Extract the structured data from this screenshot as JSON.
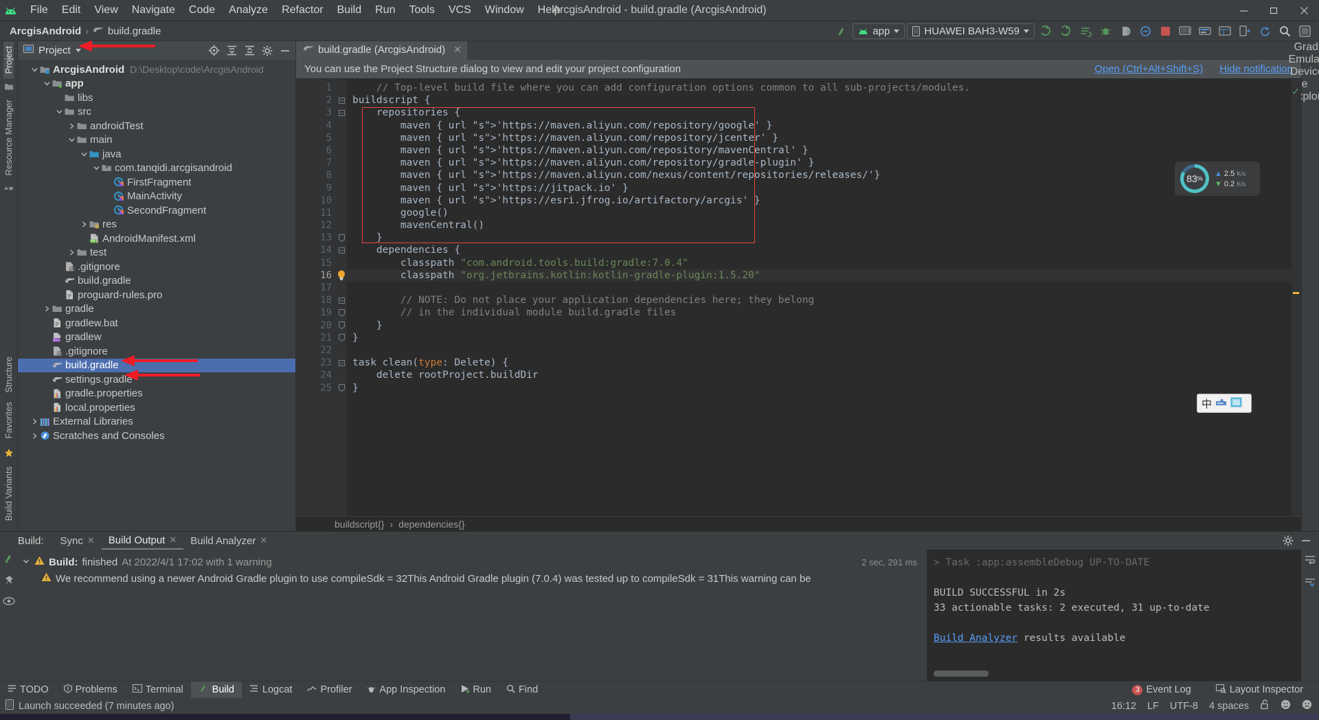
{
  "window": {
    "title": "ArcgisAndroid - build.gradle (ArcgisAndroid)",
    "app_icon": "android-logo-icon",
    "controls": {
      "minimize": "—",
      "maximize": "❐",
      "close": "✕"
    }
  },
  "menubar": [
    "File",
    "Edit",
    "View",
    "Navigate",
    "Code",
    "Analyze",
    "Refactor",
    "Build",
    "Run",
    "Tools",
    "VCS",
    "Window",
    "Help"
  ],
  "navbar": {
    "breadcrumb": {
      "project": "ArcgisAndroid",
      "separator": "›",
      "file": "build.gradle"
    },
    "run_config": {
      "label": "app",
      "icon": "android-icon"
    },
    "device": {
      "label": "HUAWEI BAH3-W59",
      "icon": "device-icon"
    },
    "icons": [
      "make-project-icon",
      "run-icon",
      "run-with-coverage-icon",
      "select-device-icon",
      "debug-icon",
      "attach-debugger-icon",
      "profiler-icon",
      "apply-changes-icon",
      "stop-icon",
      "avd-manager-icon",
      "sdk-manager-icon",
      "layout-inspector-icon",
      "device-manager-icon",
      "sync-gradle-icon",
      "search-everywhere-icon",
      "settings-icon"
    ]
  },
  "left_rail": {
    "items": [
      "Project",
      "Resource Manager"
    ],
    "bottom_items": [
      "Structure",
      "Favorites",
      "Build Variants"
    ]
  },
  "right_rail": {
    "items": [
      "Gradle",
      "Emulator",
      "Device File Explorer"
    ]
  },
  "project_panel": {
    "header": {
      "title": "Project",
      "icons": [
        "locate-icon",
        "expand-all-icon",
        "collapse-all-icon",
        "gear-icon",
        "hide-icon"
      ]
    },
    "tree": [
      {
        "depth": 0,
        "arrow": "down",
        "icon": "project-folder-icon",
        "label": "ArcgisAndroid",
        "bold": true,
        "path": "D:\\Desktop\\code\\ArcgisAndroid"
      },
      {
        "depth": 1,
        "arrow": "down",
        "icon": "module-folder-icon",
        "label": "app",
        "bold": true,
        "path": ""
      },
      {
        "depth": 2,
        "arrow": "none",
        "icon": "folder-icon",
        "label": "libs",
        "bold": false,
        "path": ""
      },
      {
        "depth": 2,
        "arrow": "down",
        "icon": "folder-icon",
        "label": "src",
        "bold": false,
        "path": ""
      },
      {
        "depth": 3,
        "arrow": "right",
        "icon": "folder-icon",
        "label": "androidTest",
        "bold": false,
        "path": ""
      },
      {
        "depth": 3,
        "arrow": "down",
        "icon": "folder-icon",
        "label": "main",
        "bold": false,
        "path": ""
      },
      {
        "depth": 4,
        "arrow": "down",
        "icon": "source-folder-icon",
        "label": "java",
        "bold": false,
        "path": ""
      },
      {
        "depth": 5,
        "arrow": "down",
        "icon": "package-icon",
        "label": "com.tanqidi.arcgisandroid",
        "bold": false,
        "path": ""
      },
      {
        "depth": 6,
        "arrow": "none",
        "icon": "kotlin-class-icon",
        "label": "FirstFragment",
        "bold": false,
        "path": ""
      },
      {
        "depth": 6,
        "arrow": "none",
        "icon": "kotlin-class-icon",
        "label": "MainActivity",
        "bold": false,
        "path": ""
      },
      {
        "depth": 6,
        "arrow": "none",
        "icon": "kotlin-class-icon",
        "label": "SecondFragment",
        "bold": false,
        "path": ""
      },
      {
        "depth": 4,
        "arrow": "right",
        "icon": "res-folder-icon",
        "label": "res",
        "bold": false,
        "path": ""
      },
      {
        "depth": 4,
        "arrow": "none",
        "icon": "manifest-icon",
        "label": "AndroidManifest.xml",
        "bold": false,
        "path": ""
      },
      {
        "depth": 3,
        "arrow": "right",
        "icon": "folder-icon",
        "label": "test",
        "bold": false,
        "path": ""
      },
      {
        "depth": 2,
        "arrow": "none",
        "icon": "gitignore-icon",
        "label": ".gitignore",
        "bold": false,
        "path": ""
      },
      {
        "depth": 2,
        "arrow": "none",
        "icon": "gradle-icon",
        "label": "build.gradle",
        "bold": false,
        "path": ""
      },
      {
        "depth": 2,
        "arrow": "none",
        "icon": "text-file-icon",
        "label": "proguard-rules.pro",
        "bold": false,
        "path": ""
      },
      {
        "depth": 1,
        "arrow": "right",
        "icon": "folder-icon",
        "label": "gradle",
        "bold": false,
        "path": ""
      },
      {
        "depth": 1,
        "arrow": "none",
        "icon": "text-file-icon",
        "label": "gradlew.bat",
        "bold": false,
        "path": ""
      },
      {
        "depth": 1,
        "arrow": "none",
        "icon": "cpp-file-icon",
        "label": "gradlew",
        "bold": false,
        "path": ""
      },
      {
        "depth": 1,
        "arrow": "none",
        "icon": "gitignore-icon",
        "label": ".gitignore",
        "bold": false,
        "path": ""
      },
      {
        "depth": 1,
        "arrow": "none",
        "icon": "gradle-icon",
        "label": "build.gradle",
        "bold": false,
        "path": "",
        "selected": true
      },
      {
        "depth": 1,
        "arrow": "none",
        "icon": "gradle-icon",
        "label": "settings.gradle",
        "bold": false,
        "path": ""
      },
      {
        "depth": 1,
        "arrow": "none",
        "icon": "properties-icon",
        "label": "gradle.properties",
        "bold": false,
        "path": ""
      },
      {
        "depth": 1,
        "arrow": "none",
        "icon": "properties-icon",
        "label": "local.properties",
        "bold": false,
        "path": ""
      },
      {
        "depth": 0,
        "arrow": "right",
        "icon": "libraries-icon",
        "label": "External Libraries",
        "bold": false,
        "path": ""
      },
      {
        "depth": 0,
        "arrow": "right",
        "icon": "scratches-icon",
        "label": "Scratches and Consoles",
        "bold": false,
        "path": ""
      }
    ]
  },
  "editor": {
    "tab": {
      "label": "build.gradle (ArcgisAndroid)",
      "icon": "gradle-icon",
      "close": "✕"
    },
    "notification": {
      "text": "You can use the Project Structure dialog to view and edit your project configuration",
      "open_link": "Open (Ctrl+Alt+Shift+S)",
      "hide_link": "Hide notification"
    },
    "current_line": 16,
    "lines": [
      {
        "n": 1,
        "text": "    // Top-level build file where you can add configuration options common to all sub-projects/modules.",
        "style": "comment",
        "fold": "none"
      },
      {
        "n": 2,
        "text": "buildscript {",
        "style": "code",
        "fold": "open"
      },
      {
        "n": 3,
        "text": "    repositories {",
        "style": "code",
        "fold": "open"
      },
      {
        "n": 4,
        "text": "        maven { url 'https://maven.aliyun.com/repository/google' }",
        "style": "code",
        "fold": "none"
      },
      {
        "n": 5,
        "text": "        maven { url 'https://maven.aliyun.com/repository/jcenter' }",
        "style": "code",
        "fold": "none"
      },
      {
        "n": 6,
        "text": "        maven { url 'https://maven.aliyun.com/repository/mavenCentral' }",
        "style": "code",
        "fold": "none"
      },
      {
        "n": 7,
        "text": "        maven { url 'https://maven.aliyun.com/repository/gradle-plugin' }",
        "style": "code",
        "fold": "none"
      },
      {
        "n": 8,
        "text": "        maven { url 'https://maven.aliyun.com/nexus/content/repositories/releases/'}",
        "style": "code",
        "fold": "none"
      },
      {
        "n": 9,
        "text": "        maven { url 'https://jitpack.io' }",
        "style": "code",
        "fold": "none"
      },
      {
        "n": 10,
        "text": "        maven { url 'https://esri.jfrog.io/artifactory/arcgis' }",
        "style": "code",
        "fold": "none"
      },
      {
        "n": 11,
        "text": "        google()",
        "style": "code",
        "fold": "none"
      },
      {
        "n": 12,
        "text": "        mavenCentral()",
        "style": "code",
        "fold": "none"
      },
      {
        "n": 13,
        "text": "    }",
        "style": "code",
        "fold": "close"
      },
      {
        "n": 14,
        "text": "    dependencies {",
        "style": "code",
        "fold": "open"
      },
      {
        "n": 15,
        "text": "        classpath \"com.android.tools.build:gradle:7.0.4\"",
        "style": "code",
        "fold": "none"
      },
      {
        "n": 16,
        "text": "        classpath \"org.jetbrains.kotlin:kotlin-gradle-plugin:1.5.20\"",
        "style": "code",
        "fold": "none",
        "bulb": true
      },
      {
        "n": 17,
        "text": "",
        "style": "code",
        "fold": "none"
      },
      {
        "n": 18,
        "text": "        // NOTE: Do not place your application dependencies here; they belong",
        "style": "comment",
        "fold": "open"
      },
      {
        "n": 19,
        "text": "        // in the individual module build.gradle files",
        "style": "comment",
        "fold": "close"
      },
      {
        "n": 20,
        "text": "    }",
        "style": "code",
        "fold": "close"
      },
      {
        "n": 21,
        "text": "}",
        "style": "code",
        "fold": "close"
      },
      {
        "n": 22,
        "text": "",
        "style": "code",
        "fold": "none"
      },
      {
        "n": 23,
        "text": "task clean(type: Delete) {",
        "style": "code",
        "fold": "open",
        "gutter_run": true
      },
      {
        "n": 24,
        "text": "    delete rootProject.buildDir",
        "style": "code",
        "fold": "none"
      },
      {
        "n": 25,
        "text": "}",
        "style": "code",
        "fold": "close"
      }
    ],
    "breadcrumb": [
      "buildscript{}",
      "dependencies{}"
    ],
    "breadcrumb_sep": "›",
    "inspection_ok": "✓"
  },
  "network_widget": {
    "percent": "83",
    "percent_unit": "%",
    "upload": "2.5",
    "upload_unit": "K/s",
    "download": "0.2",
    "download_unit": "K/s"
  },
  "ime_widget": {
    "lang": "中",
    "icons": [
      "ime-keyboard-icon",
      "ime-panel-icon"
    ]
  },
  "build_panel": {
    "label": "Build:",
    "tabs": [
      {
        "label": "Sync",
        "active": false,
        "close": "✕"
      },
      {
        "label": "Build Output",
        "active": true,
        "close": "✕"
      },
      {
        "label": "Build Analyzer",
        "active": false,
        "close": "✕"
      }
    ],
    "icons": [
      "settings-icon",
      "hide-icon"
    ],
    "rail_icons": [
      "build-icon",
      "pin-icon",
      "eye-icon"
    ],
    "tree": [
      {
        "indent": 0,
        "arrow": "down",
        "icon": "warning-icon",
        "bold": "Build:",
        "text": "finished",
        "dim": "At 2022/4/1 17:02 with 1 warning",
        "time": "2 sec, 291 ms"
      },
      {
        "indent": 1,
        "arrow": "none",
        "icon": "warning-icon",
        "bold": "",
        "text": "We recommend using a newer Android Gradle plugin to use compileSdk = 32This Android Gradle plugin (7.0.4) was tested up to compileSdk = 31This warning can be",
        "dim": "",
        "time": ""
      }
    ],
    "console": [
      {
        "text": "> Task :app:assembleDebug UP-TO-DATE",
        "ghost": true
      },
      {
        "text": "",
        "ghost": false
      },
      {
        "text": "BUILD SUCCESSFUL in 2s",
        "ghost": false
      },
      {
        "text": "33 actionable tasks: 2 executed, 31 up-to-date",
        "ghost": false
      },
      {
        "text": "",
        "ghost": false
      },
      {
        "text": "Build Analyzer results available",
        "ghost": false,
        "link": "Build Analyzer",
        "link_suffix": " results available"
      }
    ]
  },
  "toolwindow_bar": {
    "items": [
      {
        "label": "TODO",
        "icon": "todo-icon",
        "active": false
      },
      {
        "label": "Problems",
        "icon": "problems-icon",
        "active": false
      },
      {
        "label": "Terminal",
        "icon": "terminal-icon",
        "active": false
      },
      {
        "label": "Build",
        "icon": "build-icon",
        "active": true
      },
      {
        "label": "Logcat",
        "icon": "logcat-icon",
        "active": false
      },
      {
        "label": "Profiler",
        "icon": "profiler-icon",
        "active": false
      },
      {
        "label": "App Inspection",
        "icon": "app-inspection-icon",
        "active": false
      },
      {
        "label": "Run",
        "icon": "run-icon",
        "active": false
      },
      {
        "label": "Find",
        "icon": "find-icon",
        "active": false
      }
    ],
    "right": [
      {
        "label": "Event Log",
        "badge": "3",
        "icon": "event-log-icon"
      },
      {
        "label": "Layout Inspector",
        "badge": "",
        "icon": "layout-inspector-icon"
      }
    ]
  },
  "statusbar": {
    "message": "Launch succeeded (7 minutes ago)",
    "message_icon": "device-icon",
    "time": "16:12",
    "line_ending": "LF",
    "encoding": "UTF-8",
    "indent": "4 spaces",
    "lock_icon": "unlocked-icon",
    "happy_icon": "happy-face-icon",
    "sad_icon": "sad-face-icon"
  },
  "colors": {
    "accent_blue": "#4b6eaf",
    "link_blue": "#589df6",
    "warning_amber": "#f0a732",
    "string_green": "#6a8759",
    "keyword_orange": "#cc7832",
    "comment_gray": "#808080",
    "annotation_red": "#e8453c",
    "badge_red": "#c75450",
    "android_green": "#3ddc84"
  }
}
